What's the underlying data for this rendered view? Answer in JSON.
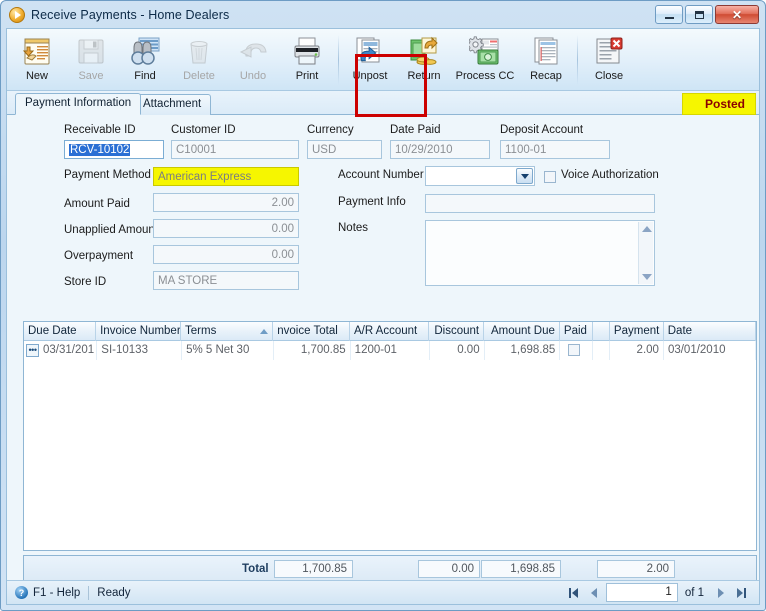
{
  "window": {
    "title": "Receive Payments - Home Dealers",
    "app_icon": "play-circle-icon",
    "buttons": {
      "minimize": "minimize-icon",
      "maximize": "maximize-icon",
      "close": "✕"
    }
  },
  "toolbar": {
    "items": [
      {
        "label": "New",
        "icon": "new-document-icon",
        "enabled": true
      },
      {
        "label": "Save",
        "icon": "floppy-disk-icon",
        "enabled": false
      },
      {
        "label": "Find",
        "icon": "binoculars-icon",
        "enabled": true
      },
      {
        "label": "Delete",
        "icon": "trash-can-icon",
        "enabled": false
      },
      {
        "label": "Undo",
        "icon": "undo-arrow-icon",
        "enabled": false
      },
      {
        "label": "Print",
        "icon": "printer-icon",
        "enabled": true
      },
      {
        "label": "Unpost",
        "icon": "unpost-icon",
        "enabled": true
      },
      {
        "label": "Return",
        "icon": "return-money-icon",
        "enabled": true
      },
      {
        "label": "Process CC",
        "icon": "process-cc-icon",
        "enabled": true,
        "highlighted": true
      },
      {
        "label": "Recap",
        "icon": "recap-report-icon",
        "enabled": true
      },
      {
        "label": "Close",
        "icon": "close-document-icon",
        "enabled": true
      }
    ]
  },
  "tabs": {
    "items": [
      {
        "label": "Payment Information",
        "active": true
      },
      {
        "label": "Attachment",
        "active": false
      }
    ],
    "status_badge": "Posted"
  },
  "form": {
    "receivable_id": {
      "label": "Receivable ID",
      "value": "RCV-10102",
      "selected": true
    },
    "customer_id": {
      "label": "Customer ID",
      "value": "C10001"
    },
    "currency": {
      "label": "Currency",
      "value": "USD"
    },
    "date_paid": {
      "label": "Date Paid",
      "value": "10/29/2010"
    },
    "deposit_account": {
      "label": "Deposit Account",
      "value": "1100-01"
    },
    "payment_method": {
      "label": "Payment Method",
      "value": "American Express",
      "highlighted": true
    },
    "amount_paid": {
      "label": "Amount Paid",
      "value": "2.00"
    },
    "unapplied_amount": {
      "label": "Unapplied Amount",
      "value": "0.00"
    },
    "overpayment": {
      "label": "Overpayment",
      "value": "0.00"
    },
    "store_id": {
      "label": "Store ID",
      "value": "MA STORE"
    },
    "account_number": {
      "label": "Account Number",
      "value": ""
    },
    "voice_authorization": {
      "label": "Voice Authorization",
      "checked": false
    },
    "payment_info": {
      "label": "Payment Info",
      "value": ""
    },
    "notes": {
      "label": "Notes",
      "value": ""
    }
  },
  "grid": {
    "columns": [
      {
        "label": "Due Date",
        "width": 78,
        "align": "left",
        "sorted": false
      },
      {
        "label": "Invoice Number",
        "width": 92,
        "align": "left",
        "sorted": false
      },
      {
        "label": "Terms",
        "width": 100,
        "align": "left",
        "sorted": true
      },
      {
        "label": "nvoice Total",
        "width": 83,
        "align": "left",
        "sorted": false
      },
      {
        "label": "A/R Account",
        "width": 86,
        "align": "left",
        "sorted": false
      },
      {
        "label": "Discount",
        "width": 59,
        "align": "right",
        "sorted": false
      },
      {
        "label": "Amount Due",
        "width": 82,
        "align": "right",
        "sorted": false
      },
      {
        "label": "Paid",
        "width": 35,
        "align": "left",
        "sorted": false
      },
      {
        "label": "",
        "width": 18,
        "align": "left",
        "sorted": false
      },
      {
        "label": "Payment",
        "width": 58,
        "align": "right",
        "sorted": false
      },
      {
        "label": "Date",
        "width": 100,
        "align": "left",
        "sorted": false
      }
    ],
    "rows": [
      {
        "row_button": "row-selector-ellipsis",
        "due_date": "03/31/201",
        "invoice_number": "SI-10133",
        "terms": "5% 5 Net 30",
        "invoice_total": "1,700.85",
        "ar_account": "1200-01",
        "discount": "0.00",
        "amount_due": "1,698.85",
        "paid": false,
        "payment": "2.00",
        "date": "03/01/2010"
      }
    ]
  },
  "totals": {
    "label": "Total",
    "invoice_total": "1,700.85",
    "discount": "0.00",
    "amount_due": "1,698.85",
    "payment": "2.00"
  },
  "statusbar": {
    "help_icon": "help-circle-icon",
    "help_text": "F1 - Help",
    "status_text": "Ready",
    "nav": {
      "first": "first-record-icon",
      "prev": "previous-record-icon",
      "current_page": "1",
      "of_label": "of 1",
      "next": "next-record-icon",
      "last": "last-record-icon"
    }
  },
  "colors": {
    "accent": "#2a6fd4",
    "highlight_yellow": "#f6f600",
    "annotation_red": "#cc0000",
    "posted_text": "#8b0000"
  }
}
